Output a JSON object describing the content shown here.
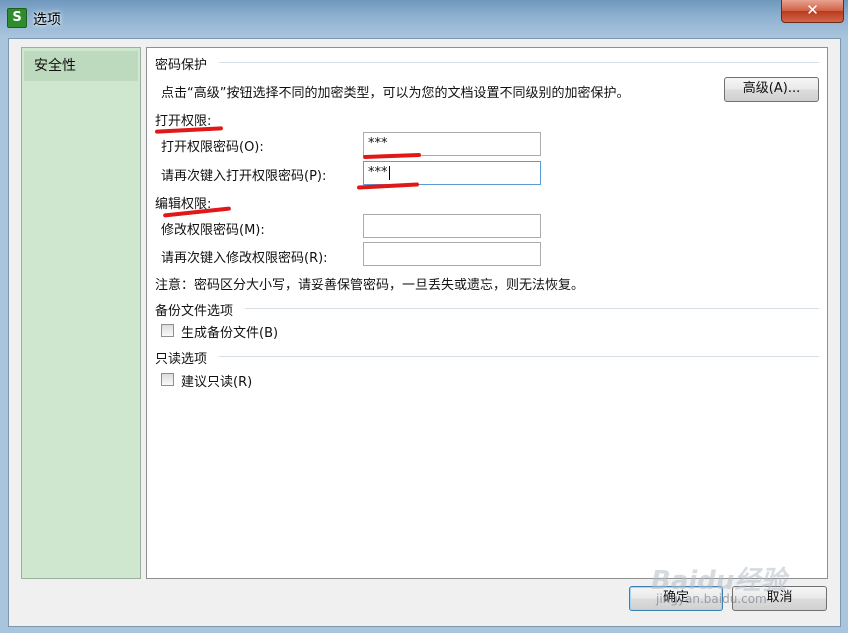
{
  "window": {
    "title": "选项",
    "app_icon": "S",
    "close_label": "X"
  },
  "nav": {
    "items": [
      {
        "label": "安全性",
        "selected": true
      }
    ]
  },
  "password_protection": {
    "section_title": "密码保护",
    "description": "点击“高级”按钮选择不同的加密类型，可以为您的文档设置不同级别的加密保护。",
    "advanced_button": "高级(A)..."
  },
  "open_permission": {
    "section_title": "打开权限:",
    "password_label": "打开权限密码(O):",
    "password_value": "***",
    "confirm_label": "请再次键入打开权限密码(P):",
    "confirm_value": "***"
  },
  "edit_permission": {
    "section_title": "编辑权限:",
    "password_label": "修改权限密码(M):",
    "password_value": "",
    "confirm_label": "请再次键入修改权限密码(R):",
    "confirm_value": ""
  },
  "note": "注意：密码区分大小写，请妥善保管密码，一旦丢失或遗忘，则无法恢复。",
  "backup": {
    "section_title": "备份文件选项",
    "checkbox_label": "生成备份文件(B)",
    "checked": false
  },
  "readonly": {
    "section_title": "只读选项",
    "checkbox_label": "建议只读(R)",
    "checked": false
  },
  "footer": {
    "ok_label": "确定",
    "cancel_label": "取消"
  },
  "watermark": {
    "text": "Baidu经验",
    "url": "jingyan.baidu.com"
  },
  "colors": {
    "annotation_red": "#e01818",
    "nav_background": "#cfe6cf",
    "focus_border": "#5b9bd5"
  }
}
